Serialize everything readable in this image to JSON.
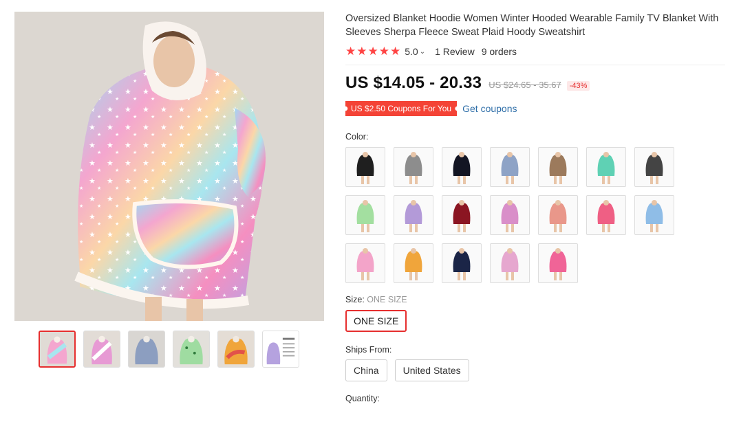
{
  "gallery": {
    "main_image": "oversized-blanket-hoodie-rainbow-stars",
    "thumbnails": [
      "rainbow-stars",
      "pink-white-tie-dye",
      "grey-blue-stars",
      "green-print",
      "orange-tie-dye",
      "size-chart"
    ]
  },
  "product": {
    "title": "Oversized Blanket Hoodie Women Winter Hooded Wearable Family TV Blanket With Sleeves Sherpa Fleece Sweat Plaid Hoody Sweatshirt",
    "rating": "5.0",
    "reviews": "1 Review",
    "orders": "9 orders",
    "price": "US $14.05 - 20.33",
    "original_price": "US $24.65 - 35.67",
    "discount": "-43%",
    "coupon": "US $2.50 Coupons For You",
    "get_coupons": "Get coupons"
  },
  "color": {
    "label": "Color:",
    "swatches": [
      {
        "name": "black",
        "color": "#1f1f1f"
      },
      {
        "name": "grey",
        "color": "#8d8d8d"
      },
      {
        "name": "black-navy",
        "color": "#131523"
      },
      {
        "name": "blue-grey",
        "color": "#8ea3c6"
      },
      {
        "name": "brown",
        "color": "#9c7a5c"
      },
      {
        "name": "mint",
        "color": "#5fd1b4"
      },
      {
        "name": "cow-print",
        "color": "#444444"
      },
      {
        "name": "green-print",
        "color": "#a3dfa0"
      },
      {
        "name": "purple-tie-dye",
        "color": "#b39ad8"
      },
      {
        "name": "wine-red",
        "color": "#8b1522"
      },
      {
        "name": "pink-white",
        "color": "#d98fc9"
      },
      {
        "name": "peach-tie-dye",
        "color": "#e9978a"
      },
      {
        "name": "pink-red",
        "color": "#ef5f84"
      },
      {
        "name": "light-blue",
        "color": "#8fbde7"
      },
      {
        "name": "rainbow-stars",
        "color": "#f3a4c9"
      },
      {
        "name": "orange-tie-dye",
        "color": "#f0a53b"
      },
      {
        "name": "navy-galaxy",
        "color": "#1b2547"
      },
      {
        "name": "pink-stripe",
        "color": "#e6a7cf"
      },
      {
        "name": "hot-pink",
        "color": "#f06497"
      }
    ]
  },
  "size": {
    "label": "Size: ",
    "selected": "ONE SIZE",
    "option": "ONE SIZE"
  },
  "ships_from": {
    "label": "Ships From:",
    "options": [
      "China",
      "United States"
    ]
  },
  "quantity": {
    "label": "Quantity:"
  }
}
